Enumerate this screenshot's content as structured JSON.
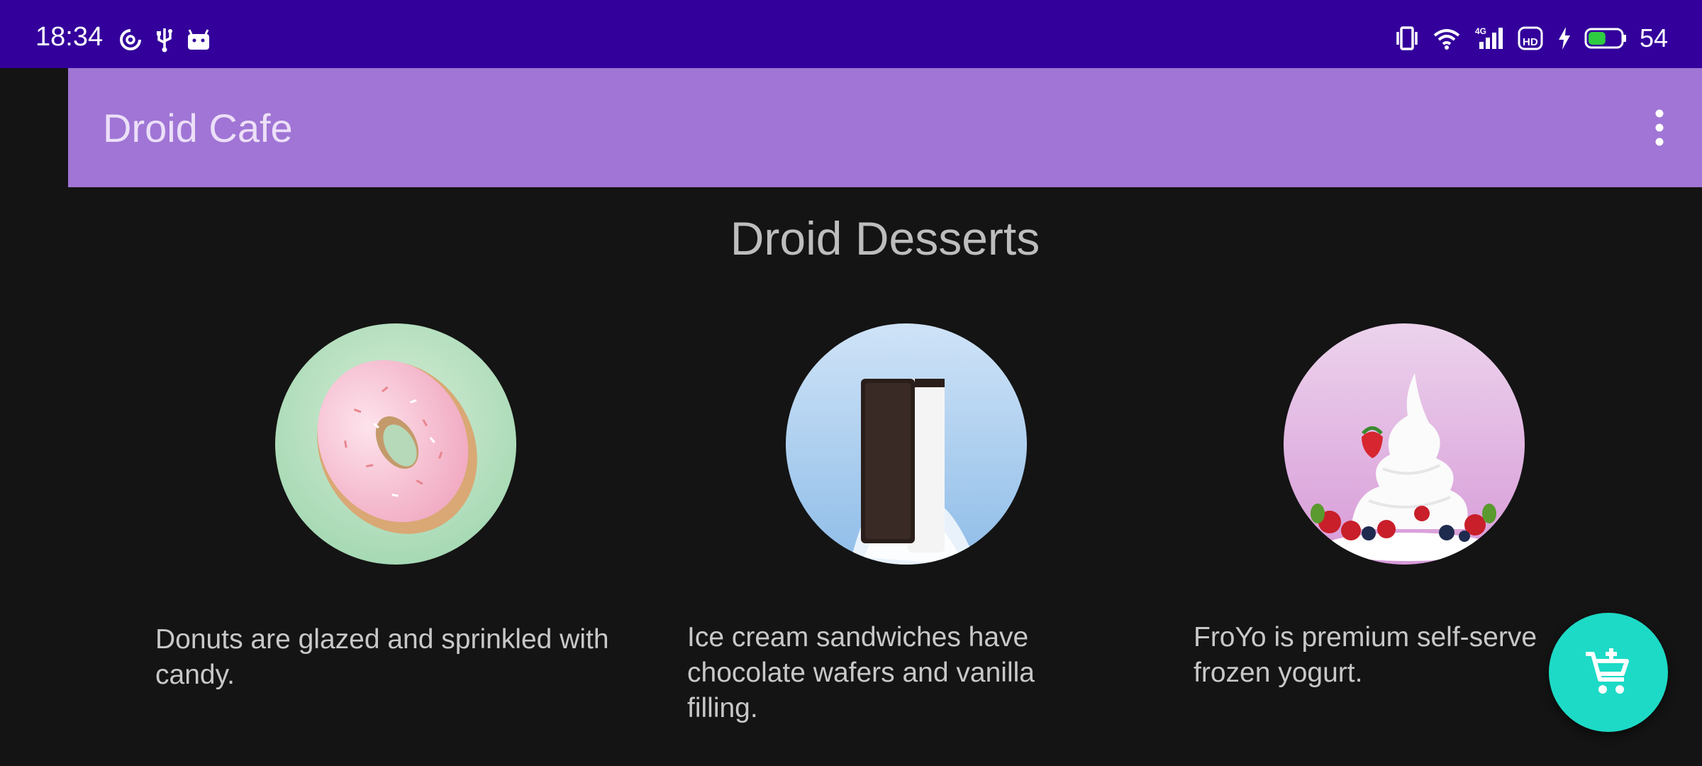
{
  "status_bar": {
    "time": "18:34",
    "battery_percent": "54",
    "left_icons": [
      "hotspot-icon",
      "usb-icon",
      "android-icon"
    ],
    "right_icons": [
      "vibrate-icon",
      "wifi-icon",
      "signal-4g-icon",
      "hd-icon",
      "charging-icon",
      "battery-icon"
    ],
    "battery_level": 0.54,
    "colors": {
      "background": "#33009b",
      "battery_fill": "#2ecc40"
    }
  },
  "app_bar": {
    "title": "Droid Cafe",
    "overflow_icon": "more-vert-icon",
    "color": "#a075d5"
  },
  "main": {
    "heading": "Droid Desserts",
    "desserts": [
      {
        "name": "donut",
        "image": "donut-image",
        "description": "Donuts are glazed and sprinkled with candy."
      },
      {
        "name": "ice-cream-sandwich",
        "image": "ice-cream-sandwich-image",
        "description": "Ice cream sandwiches have chocolate wafers and vanilla filling."
      },
      {
        "name": "froyo",
        "image": "froyo-image",
        "description": "FroYo is premium self-serve frozen yogurt."
      }
    ]
  },
  "fab": {
    "icon": "add-shopping-cart-icon",
    "color": "#1ddac6"
  }
}
